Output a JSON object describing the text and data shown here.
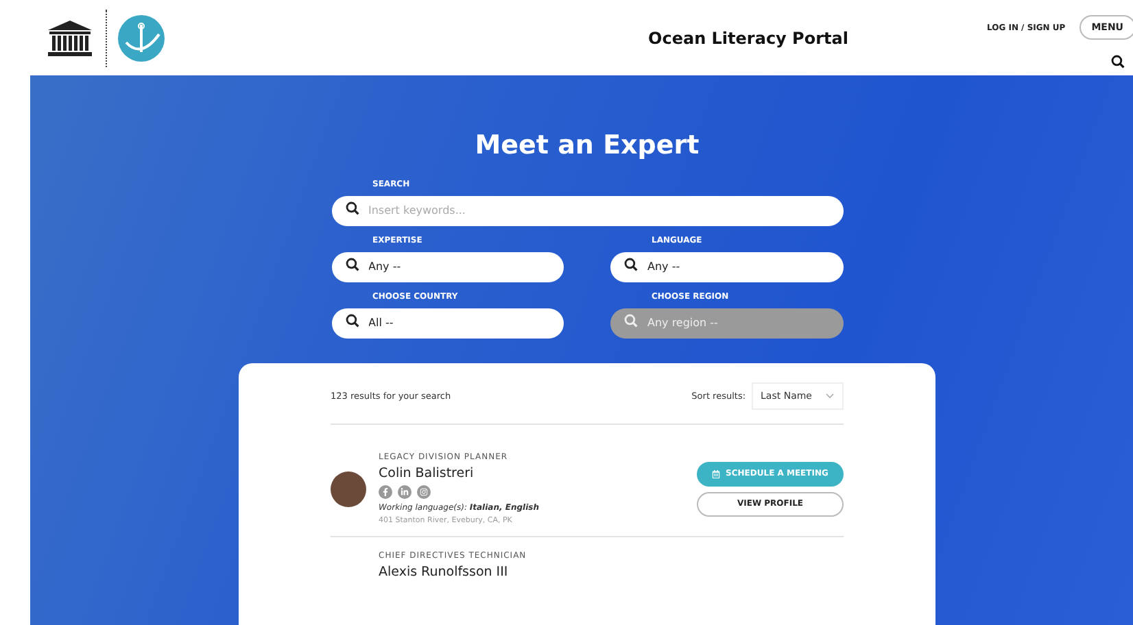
{
  "header": {
    "title": "Ocean Literacy Portal",
    "login": "LOG IN / SIGN UP",
    "menu": "MENU"
  },
  "hero": {
    "title": "Meet an Expert",
    "fields": [
      {
        "kind": "search",
        "label": "SEARCH",
        "placeholder": "Insert keywords...",
        "disabled": false
      },
      {
        "kind": "select",
        "label": "EXPERTISE",
        "value": "Any --",
        "disabled": false
      },
      {
        "kind": "select",
        "label": "LANGUAGE",
        "value": "Any --",
        "disabled": false
      },
      {
        "kind": "select",
        "label": "CHOOSE COUNTRY",
        "value": "All --",
        "disabled": false
      },
      {
        "kind": "select",
        "label": "CHOOSE REGION",
        "value": "Any region --",
        "disabled": true
      }
    ]
  },
  "results": {
    "count": "123 results for your search",
    "sort_label": "Sort results:",
    "sort_value": "Last Name",
    "experts": [
      {
        "title": "LEGACY DIVISION PLANNER",
        "name": "Colin Balistreri",
        "languages": "Working language(s): **Italian, English**",
        "address": "401 Stanton River, Evebury, CA, PK",
        "schedule": "SCHEDULE A MEETING",
        "profile": "VIEW PROFILE"
      },
      {
        "title": "CHIEF DIRECTIVES TECHNICIAN",
        "name": "Alexis Runolfsson III"
      }
    ]
  }
}
